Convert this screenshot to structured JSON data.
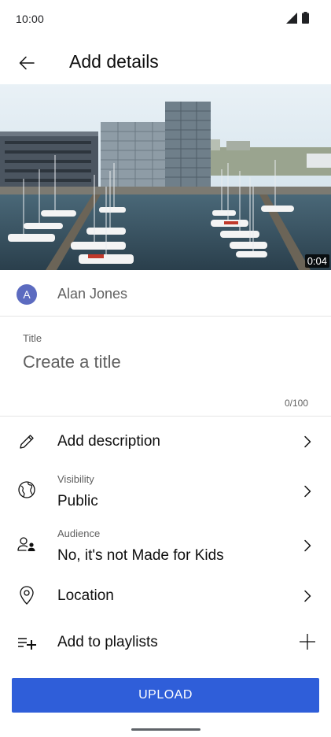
{
  "status_bar": {
    "time": "10:00"
  },
  "header": {
    "title": "Add details"
  },
  "video": {
    "duration": "0:04"
  },
  "channel": {
    "avatar_letter": "A",
    "name": "Alan Jones"
  },
  "title_field": {
    "label": "Title",
    "placeholder": "Create a title",
    "value": "",
    "counter": "0/100"
  },
  "settings": {
    "description": {
      "label": "Add description"
    },
    "visibility": {
      "label": "Visibility",
      "value": "Public"
    },
    "audience": {
      "label": "Audience",
      "value": "No, it's not Made for Kids"
    },
    "location": {
      "label": "Location"
    },
    "playlists": {
      "label": "Add to playlists"
    }
  },
  "upload_button": {
    "label": "UPLOAD"
  },
  "colors": {
    "primary": "#2f5ed9",
    "avatar": "#5c6bc0",
    "secondary_text": "#606060"
  },
  "icons": {
    "back": "arrow-left-icon",
    "description": "pencil-icon",
    "visibility": "globe-icon",
    "audience": "person-child-icon",
    "location": "location-pin-icon",
    "playlists": "playlist-add-icon",
    "chevron": "chevron-right-icon",
    "add": "plus-icon"
  }
}
